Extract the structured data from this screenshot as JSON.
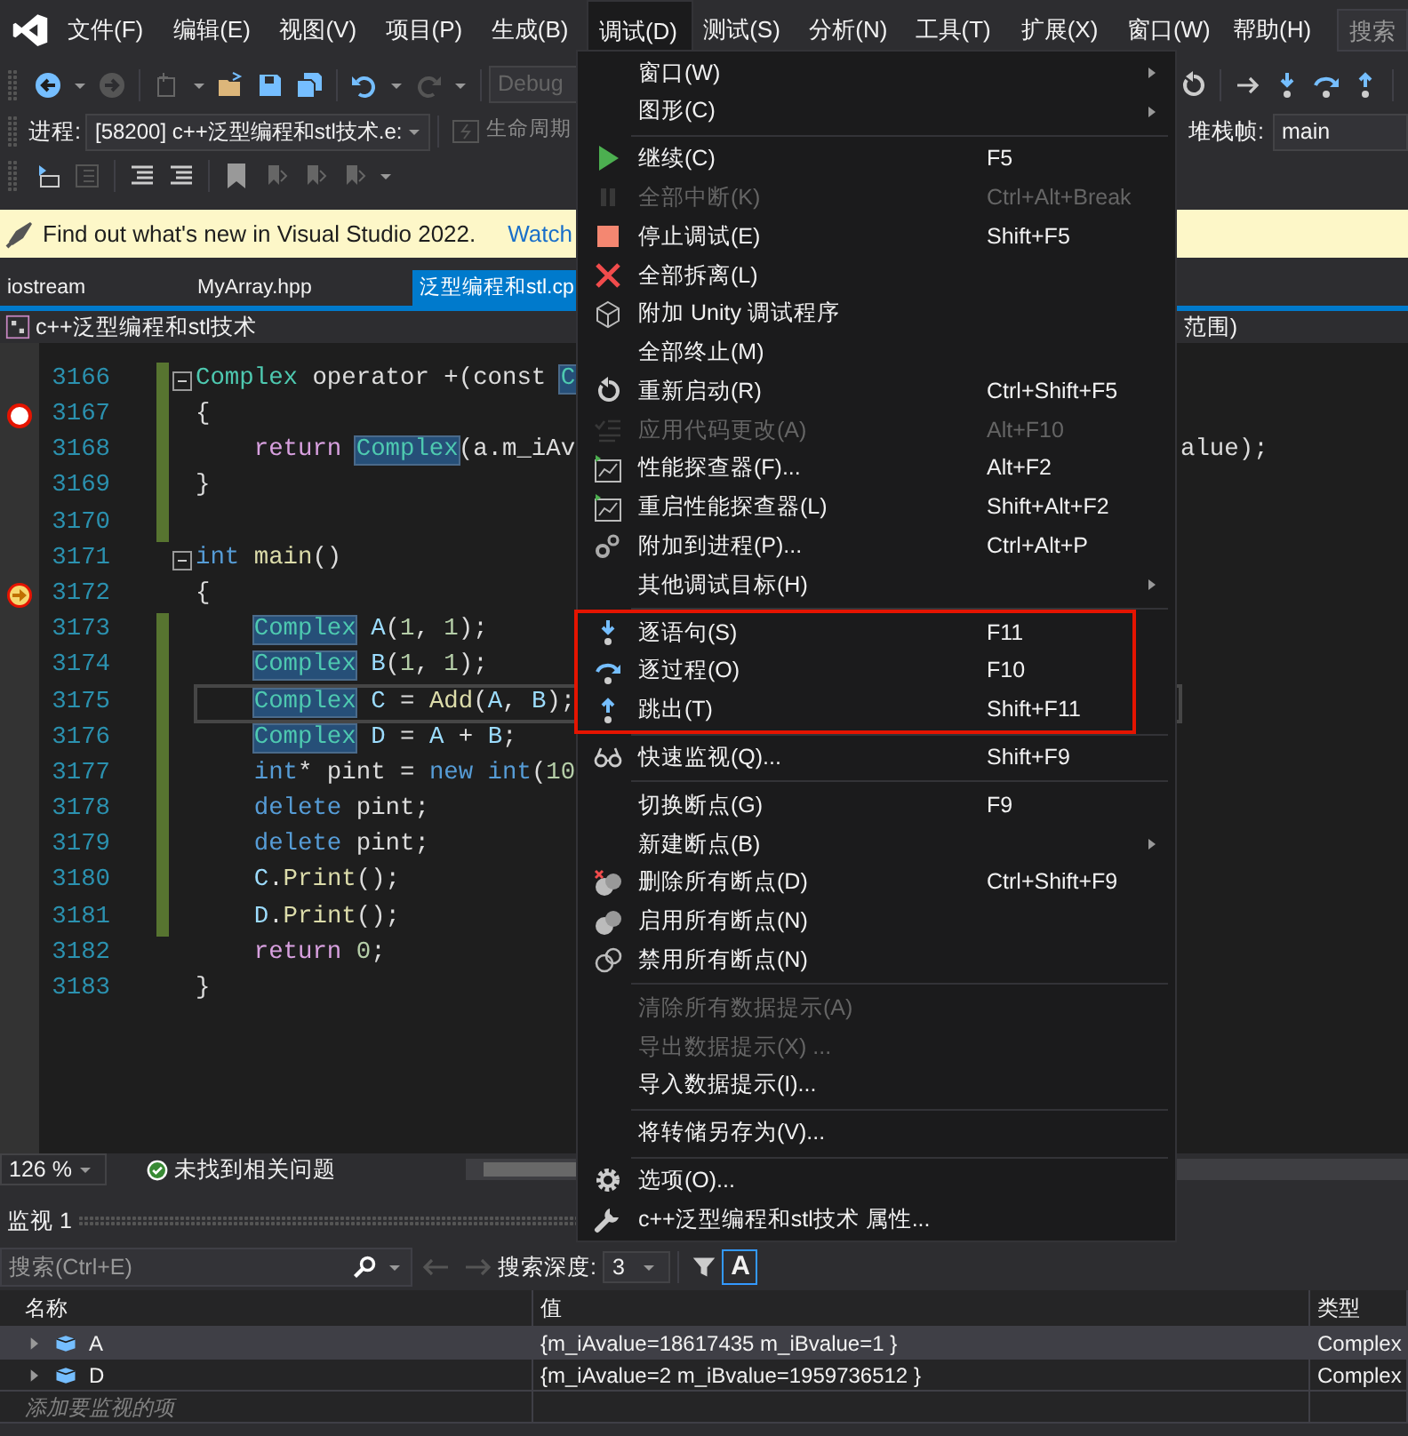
{
  "menubar": {
    "items": [
      {
        "label": "文件(F)",
        "selected": false
      },
      {
        "label": "编辑(E)",
        "selected": false
      },
      {
        "label": "视图(V)",
        "selected": false
      },
      {
        "label": "项目(P)",
        "selected": false
      },
      {
        "label": "生成(B)",
        "selected": false
      },
      {
        "label": "调试(D)",
        "selected": true
      },
      {
        "label": "测试(S)",
        "selected": false
      },
      {
        "label": "分析(N)",
        "selected": false
      },
      {
        "label": "工具(T)",
        "selected": false
      },
      {
        "label": "扩展(X)",
        "selected": false
      },
      {
        "label": "窗口(W)",
        "selected": false
      },
      {
        "label": "帮助(H)",
        "selected": false
      }
    ],
    "search": "搜索"
  },
  "toolbar": {
    "configuration": "Debug"
  },
  "debug_location": {
    "process_label": "进程:",
    "process": "[58200] c++泛型编程和stl技术.e:",
    "lifecycle": "生命周期",
    "stack_frame_label": "堆栈帧:",
    "stack_frame": "main"
  },
  "info_bar": {
    "message": "Find out what's new in Visual Studio 2022.",
    "link": "Watch"
  },
  "tabs": [
    {
      "label": "iostream",
      "selected": false
    },
    {
      "label": "MyArray.hpp",
      "selected": false
    },
    {
      "label": "泛型编程和stl.cp",
      "selected": true
    }
  ],
  "nav_bar": {
    "project": "c++泛型编程和stl技术",
    "scope": "范围)"
  },
  "editor": {
    "lines": [
      {
        "number": "3166",
        "kind": "code",
        "changed": true,
        "fold": true,
        "caret_line": false,
        "tokens": [
          {
            "text": "Complex",
            "kind": "type"
          },
          {
            "text": " operator +(const ",
            "kind": "plain"
          },
          {
            "text": "C",
            "kind": "ref"
          }
        ]
      },
      {
        "number": "3167",
        "kind": "breakpoint",
        "changed": true,
        "fold": false,
        "caret_line": false,
        "tokens": [
          {
            "text": "{",
            "kind": "plain"
          }
        ]
      },
      {
        "number": "3168",
        "kind": "code",
        "changed": true,
        "fold": false,
        "caret_line": false,
        "tokens": [
          {
            "text": "    return ",
            "kind": "control"
          },
          {
            "text": "Complex",
            "kind": "ref"
          },
          {
            "text": "(a.m_iAv",
            "kind": "plain"
          }
        ],
        "tail": "alue);"
      },
      {
        "number": "3169",
        "kind": "code",
        "changed": true,
        "fold": false,
        "caret_line": false,
        "tokens": [
          {
            "text": "}",
            "kind": "plain"
          }
        ]
      },
      {
        "number": "3170",
        "kind": "code",
        "changed": true,
        "fold": false,
        "caret_line": false
      },
      {
        "number": "3171",
        "kind": "code",
        "changed": false,
        "fold": true,
        "caret_line": false,
        "tokens": [
          {
            "text": "int ",
            "kind": "keyword"
          },
          {
            "text": "main",
            "kind": "function"
          },
          {
            "text": "()",
            "kind": "plain"
          }
        ]
      },
      {
        "number": "3172",
        "kind": "current_statement",
        "changed": false,
        "fold": false,
        "caret_line": false,
        "tokens": [
          {
            "text": "{",
            "kind": "plain"
          }
        ]
      },
      {
        "number": "3173",
        "kind": "code",
        "changed": true,
        "fold": false,
        "caret_line": false,
        "tokens": [
          {
            "text": "    Complex",
            "kind": "ref"
          },
          {
            "text": " A",
            "kind": "variable"
          },
          {
            "text": "(",
            "kind": "plain"
          },
          {
            "text": "1",
            "kind": "number"
          },
          {
            "text": ", ",
            "kind": "plain"
          },
          {
            "text": "1",
            "kind": "number"
          },
          {
            "text": ");",
            "kind": "plain"
          }
        ]
      },
      {
        "number": "3174",
        "kind": "code",
        "changed": true,
        "fold": false,
        "caret_line": false,
        "tokens": [
          {
            "text": "    Complex",
            "kind": "ref"
          },
          {
            "text": " B",
            "kind": "variable"
          },
          {
            "text": "(",
            "kind": "plain"
          },
          {
            "text": "1",
            "kind": "number"
          },
          {
            "text": ", ",
            "kind": "plain"
          },
          {
            "text": "1",
            "kind": "number"
          },
          {
            "text": ");",
            "kind": "plain"
          }
        ]
      },
      {
        "number": "3175",
        "kind": "code",
        "changed": true,
        "fold": false,
        "caret_line": true,
        "tokens": [
          {
            "text": "    Complex",
            "kind": "ref"
          },
          {
            "text": " C",
            "kind": "variable"
          },
          {
            "text": " = ",
            "kind": "plain"
          },
          {
            "text": "Add",
            "kind": "function"
          },
          {
            "text": "(",
            "kind": "plain"
          },
          {
            "text": "A",
            "kind": "variable"
          },
          {
            "text": ", ",
            "kind": "plain"
          },
          {
            "text": "B",
            "kind": "variable"
          },
          {
            "text": ");",
            "kind": "plain"
          }
        ]
      },
      {
        "number": "3176",
        "kind": "code",
        "changed": true,
        "fold": false,
        "caret_line": false,
        "tokens": [
          {
            "text": "    Complex",
            "kind": "ref"
          },
          {
            "text": " D",
            "kind": "variable"
          },
          {
            "text": " = ",
            "kind": "plain"
          },
          {
            "text": "A",
            "kind": "variable"
          },
          {
            "text": " + ",
            "kind": "plain"
          },
          {
            "text": "B",
            "kind": "variable"
          },
          {
            "text": ";",
            "kind": "plain"
          }
        ]
      },
      {
        "number": "3177",
        "kind": "code",
        "changed": true,
        "fold": false,
        "caret_line": false,
        "tokens": [
          {
            "text": "    int",
            "kind": "keyword"
          },
          {
            "text": "* pint = ",
            "kind": "plain"
          },
          {
            "text": "new int",
            "kind": "keyword"
          },
          {
            "text": "(",
            "kind": "plain"
          },
          {
            "text": "10",
            "kind": "number"
          }
        ]
      },
      {
        "number": "3178",
        "kind": "code",
        "changed": true,
        "fold": false,
        "caret_line": false,
        "tokens": [
          {
            "text": "    delete",
            "kind": "keyword"
          },
          {
            "text": " pint;",
            "kind": "plain"
          }
        ]
      },
      {
        "number": "3179",
        "kind": "code",
        "changed": true,
        "fold": false,
        "caret_line": false,
        "tokens": [
          {
            "text": "    delete",
            "kind": "keyword"
          },
          {
            "text": " pint;",
            "kind": "plain"
          }
        ]
      },
      {
        "number": "3180",
        "kind": "code",
        "changed": true,
        "fold": false,
        "caret_line": false,
        "tokens": [
          {
            "text": "    C",
            "kind": "variable"
          },
          {
            "text": ".",
            "kind": "plain"
          },
          {
            "text": "Print",
            "kind": "function"
          },
          {
            "text": "();",
            "kind": "plain"
          }
        ]
      },
      {
        "number": "3181",
        "kind": "code",
        "changed": true,
        "fold": false,
        "caret_line": false,
        "tokens": [
          {
            "text": "    D",
            "kind": "variable"
          },
          {
            "text": ".",
            "kind": "plain"
          },
          {
            "text": "Print",
            "kind": "function"
          },
          {
            "text": "();",
            "kind": "plain"
          }
        ]
      },
      {
        "number": "3182",
        "kind": "code",
        "changed": false,
        "fold": false,
        "caret_line": false,
        "tokens": [
          {
            "text": "    return ",
            "kind": "control"
          },
          {
            "text": "0",
            "kind": "number"
          },
          {
            "text": ";",
            "kind": "plain"
          }
        ]
      },
      {
        "number": "3183",
        "kind": "code",
        "changed": false,
        "fold": false,
        "caret_line": false,
        "tokens": [
          {
            "text": "}",
            "kind": "plain"
          }
        ]
      }
    ]
  },
  "status_bar": {
    "zoom": "126 %",
    "issues": "未找到相关问题"
  },
  "watch": {
    "title": "监视 1",
    "search": {
      "placeholder": "搜索(Ctrl+E)"
    },
    "depth_label": "搜索深度:",
    "depth": "3",
    "case_toggle": {
      "label": "A",
      "on": true
    },
    "columns": [
      "名称",
      "值",
      "类型"
    ],
    "rows": [
      {
        "name": "A",
        "value": "{m_iAvalue=18617435 m_iBvalue=1 }",
        "type": "Complex",
        "selected": true,
        "expanded": false
      },
      {
        "name": "D",
        "value": "{m_iAvalue=2 m_iBvalue=1959736512 }",
        "type": "Complex",
        "selected": false,
        "expanded": false
      }
    ],
    "add_placeholder": "添加要监视的项"
  },
  "debug_menu": {
    "sections": [
      {
        "annotated": false,
        "items": [
          {
            "label": "窗口(W)",
            "disabled": false,
            "submenu": true
          },
          {
            "label": "图形(C)",
            "disabled": false,
            "submenu": true
          }
        ]
      },
      {
        "annotated": false,
        "items": [
          {
            "label": "继续(C)",
            "shortcut": "F5",
            "disabled": false,
            "submenu": false
          },
          {
            "label": "全部中断(K)",
            "shortcut": "Ctrl+Alt+Break",
            "disabled": true,
            "submenu": false
          },
          {
            "label": "停止调试(E)",
            "shortcut": "Shift+F5",
            "disabled": false,
            "submenu": false
          },
          {
            "label": "全部拆离(L)",
            "disabled": false,
            "submenu": false
          },
          {
            "label": "附加 Unity 调试程序",
            "disabled": false,
            "submenu": false
          },
          {
            "label": "全部终止(M)",
            "disabled": false,
            "submenu": false
          },
          {
            "label": "重新启动(R)",
            "shortcut": "Ctrl+Shift+F5",
            "disabled": false,
            "submenu": false
          },
          {
            "label": "应用代码更改(A)",
            "shortcut": "Alt+F10",
            "disabled": true,
            "submenu": false
          },
          {
            "label": "性能探查器(F)...",
            "shortcut": "Alt+F2",
            "disabled": false,
            "submenu": false
          },
          {
            "label": "重启性能探查器(L)",
            "shortcut": "Shift+Alt+F2",
            "disabled": false,
            "submenu": false
          },
          {
            "label": "附加到进程(P)...",
            "shortcut": "Ctrl+Alt+P",
            "disabled": false,
            "submenu": false
          },
          {
            "label": "其他调试目标(H)",
            "disabled": false,
            "submenu": true
          }
        ]
      },
      {
        "annotated": true,
        "items": [
          {
            "label": "逐语句(S)",
            "shortcut": "F11",
            "disabled": false,
            "submenu": false
          },
          {
            "label": "逐过程(O)",
            "shortcut": "F10",
            "disabled": false,
            "submenu": false
          },
          {
            "label": "跳出(T)",
            "shortcut": "Shift+F11",
            "disabled": false,
            "submenu": false
          }
        ]
      },
      {
        "annotated": false,
        "items": [
          {
            "label": "快速监视(Q)...",
            "shortcut": "Shift+F9",
            "disabled": false,
            "submenu": false
          }
        ]
      },
      {
        "annotated": false,
        "items": [
          {
            "label": "切换断点(G)",
            "shortcut": "F9",
            "disabled": false,
            "submenu": false
          },
          {
            "label": "新建断点(B)",
            "disabled": false,
            "submenu": true
          },
          {
            "label": "删除所有断点(D)",
            "shortcut": "Ctrl+Shift+F9",
            "disabled": false,
            "submenu": false
          },
          {
            "label": "启用所有断点(N)",
            "disabled": false,
            "submenu": false
          },
          {
            "label": "禁用所有断点(N)",
            "disabled": false,
            "submenu": false
          }
        ]
      },
      {
        "annotated": false,
        "items": [
          {
            "label": "清除所有数据提示(A)",
            "disabled": true,
            "submenu": false
          },
          {
            "label": "导出数据提示(X) ...",
            "disabled": true,
            "submenu": false
          },
          {
            "label": "导入数据提示(I)...",
            "disabled": false,
            "submenu": false
          }
        ]
      },
      {
        "annotated": false,
        "items": [
          {
            "label": "将转储另存为(V)...",
            "disabled": false,
            "submenu": false
          }
        ]
      },
      {
        "annotated": false,
        "items": [
          {
            "label": "选项(O)...",
            "disabled": false,
            "submenu": false
          },
          {
            "label": "c++泛型编程和stl技术 属性...",
            "disabled": false,
            "submenu": false
          }
        ]
      }
    ]
  }
}
